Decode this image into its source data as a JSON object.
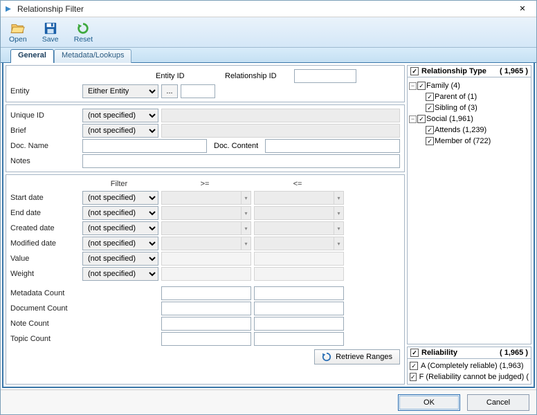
{
  "window": {
    "title": "Relationship Filter",
    "close": "✕"
  },
  "toolbar": {
    "open": "Open",
    "save": "Save",
    "reset": "Reset"
  },
  "tabs": {
    "general": "General",
    "metadata": "Metadata/Lookups"
  },
  "top": {
    "entity_id_lbl": "Entity ID",
    "rel_id_lbl": "Relationship ID",
    "entity_lbl": "Entity",
    "entity_sel": "Either Entity",
    "dots": "..."
  },
  "mid": {
    "uid": "Unique ID",
    "brief": "Brief",
    "docname": "Doc. Name",
    "doccontent": "Doc. Content",
    "notes": "Notes",
    "ns": "(not specified)"
  },
  "filter": {
    "hdr_filter": "Filter",
    "hdr_ge": ">=",
    "hdr_le": "<=",
    "start": "Start date",
    "end": "End date",
    "created": "Created date",
    "modified": "Modified date",
    "value": "Value",
    "weight": "Weight",
    "ns": "(not specified)",
    "meta": "Metadata Count",
    "doc": "Document Count",
    "note": "Note Count",
    "topic": "Topic Count",
    "retrieve": "Retrieve Ranges"
  },
  "reltype": {
    "title": "Relationship Type",
    "count": "( 1,965 )",
    "family": "Family (4)",
    "parent": "Parent of (1)",
    "sibling": "Sibling of (3)",
    "social": "Social (1,961)",
    "attends": "Attends (1,239)",
    "member": "Member of (722)"
  },
  "reliability": {
    "title": "Reliability",
    "count": "( 1,965 )",
    "a": "A (Completely reliable) (1,963)",
    "f": "F (Reliability cannot be judged) ("
  },
  "footer": {
    "ok": "OK",
    "cancel": "Cancel"
  }
}
